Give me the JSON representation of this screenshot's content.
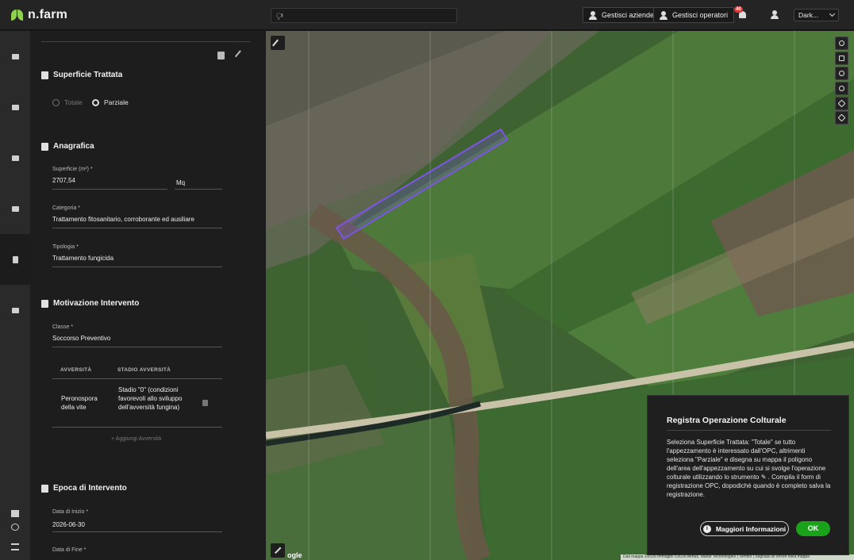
{
  "app": {
    "brand": "n.farm"
  },
  "header": {
    "search_value": "🖓",
    "btn_companies": "Gestisci aziende",
    "btn_operators": "Gestisci operatori",
    "notif_count": "40",
    "theme_value": "Dark..."
  },
  "panel": {
    "surface": {
      "title": "Superficie Trattata",
      "opt_total": "Totale",
      "opt_partial": "Parziale",
      "selected": "Parziale"
    },
    "anagrafica": {
      "title": "Anagrafica",
      "area_label": "Superficie (m²) *",
      "area_value": "2707,54",
      "unit_value": "Mq",
      "category_label": "Categoria *",
      "category_value": "Trattamento fitosanitario, corroborante ed ausiliare",
      "type_label": "Tipologia *",
      "type_value": "Trattamento fungicida"
    },
    "motivazione": {
      "title": "Motivazione Intervento",
      "class_label": "Classe *",
      "class_value": "Soccorso Preventivo",
      "col_adversity": "AVVERSITÀ",
      "col_stage": "STADIO AVVERSITÀ",
      "rows": [
        {
          "adversity": "Peronospora della vite",
          "stage": "Stadio \"0\" (condizioni favorevoli allo sviluppo dell'avversità fungina)"
        }
      ],
      "add_label": "+ Aggiungi Avversità"
    },
    "epoca": {
      "title": "Epoca di Intervento",
      "start_label": "Data di Inizio *",
      "start_value": "2026-06-30",
      "end_label": "Data di Fine *"
    }
  },
  "map": {
    "google_label": "ogle",
    "attribution": "Dati mappa ©2026 Immagini ©2026 Airbus, Maxar Technologies | Termini | Segnala un errore nella mappa",
    "polygon_color": "#7c55e6"
  },
  "dialog": {
    "title": "Registra Operazione Colturale",
    "body": "Seleziona Superficie Trattata: \"Totale\" se tutto l'appezzamento è interessato dall'OPC, altrimenti seleziona \"Parziale\" e disegna su mappa il poligono dell'area dell'appezzamento su cui si svolge l'operazione colturale utilizzando lo strumento ✎ . Compila il form di registrazione OPC, dopodichè quando è completo salva la registrazione.",
    "info_label": "Maggiori Informazioni",
    "ok_label": "OK"
  },
  "colors": {
    "brand_green": "#8fd14f",
    "ok_green": "#1aa31a",
    "badge_red": "#e23636"
  }
}
